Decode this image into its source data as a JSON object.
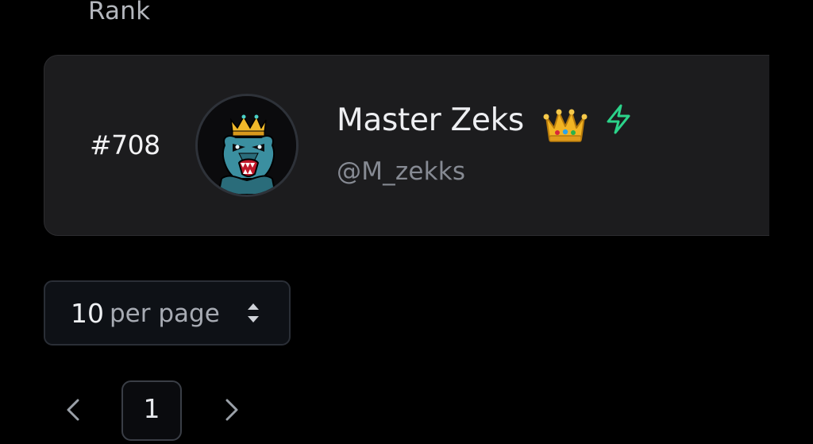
{
  "table": {
    "rank_header": "Rank"
  },
  "entry": {
    "rank": "#708",
    "display_name": "Master Zeks",
    "handle": "@M_zekks",
    "avatar_icon": "gorilla-crown-icon",
    "badge_icons": [
      "crown-icon",
      "lightning-bolt-icon"
    ]
  },
  "pagination": {
    "per_page_value": "10",
    "per_page_suffix": "per page",
    "current_page": "1",
    "prev_icon": "chevron-left-icon",
    "next_icon": "chevron-right-icon"
  },
  "colors": {
    "background": "#000000",
    "card": "#1c1c1e",
    "bolt": "#2bd38a",
    "crown": "#f2b423",
    "muted_text": "#868a93"
  }
}
